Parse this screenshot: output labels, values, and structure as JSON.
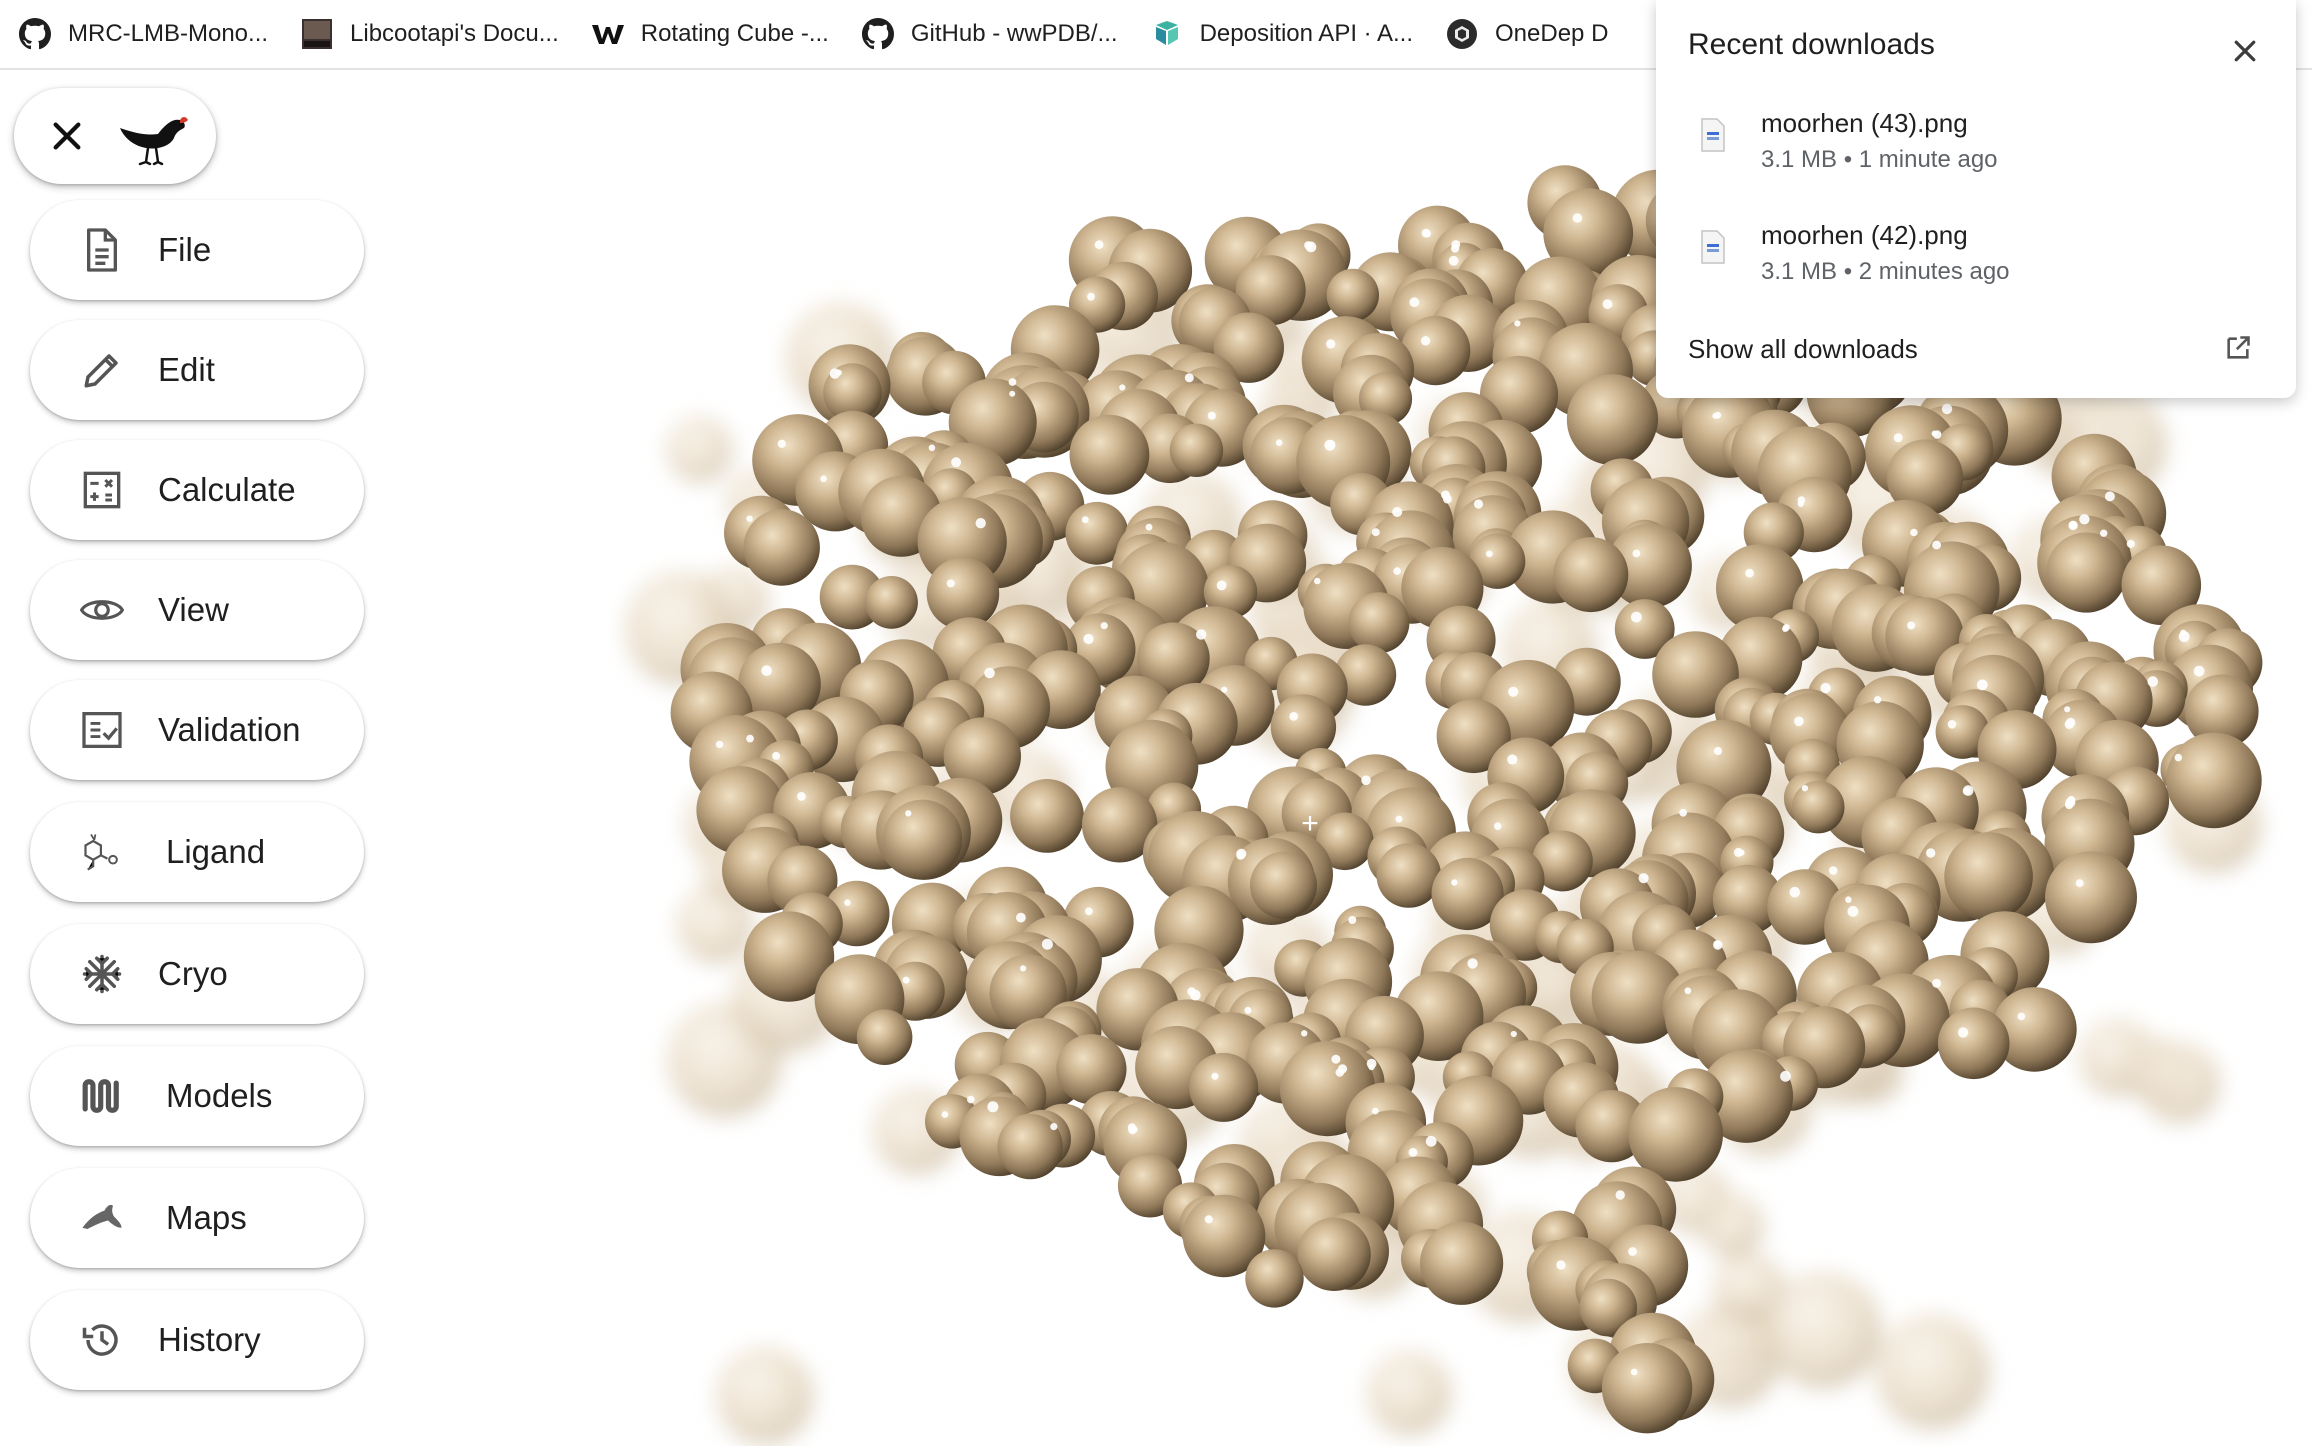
{
  "bookmarks": [
    {
      "label": "MRC-LMB-Mono...",
      "icon": "github-icon"
    },
    {
      "label": "Libcootapi's Docu...",
      "icon": "mrc-lmb-icon"
    },
    {
      "label": "Rotating Cube -...",
      "icon": "webflow-icon"
    },
    {
      "label": "GitHub - wwPDB/...",
      "icon": "github-icon"
    },
    {
      "label": "Deposition API · A...",
      "icon": "deposition-icon"
    },
    {
      "label": "OneDep D",
      "icon": "onedep-icon"
    }
  ],
  "app": {
    "logo": "moorhen-bird-icon",
    "close_icon": "close-icon"
  },
  "menu": [
    {
      "label": "File",
      "icon": "file-icon"
    },
    {
      "label": "Edit",
      "icon": "pencil-icon"
    },
    {
      "label": "Calculate",
      "icon": "calculator-icon"
    },
    {
      "label": "View",
      "icon": "eye-icon"
    },
    {
      "label": "Validation",
      "icon": "checklist-icon"
    },
    {
      "label": "Ligand",
      "icon": "ligand-icon"
    },
    {
      "label": "Cryo",
      "icon": "snowflake-icon"
    },
    {
      "label": "Models",
      "icon": "models-icon"
    },
    {
      "label": "Maps",
      "icon": "maps-icon"
    },
    {
      "label": "History",
      "icon": "history-icon"
    }
  ],
  "downloads": {
    "title": "Recent downloads",
    "items": [
      {
        "name": "moorhen (43).png",
        "meta": "3.1 MB • 1 minute ago"
      },
      {
        "name": "moorhen (42).png",
        "meta": "3.1 MB • 2 minutes ago"
      }
    ],
    "show_all": "Show all downloads"
  },
  "colors": {
    "surface": "#c9b08c",
    "surface_shadow": "#4e3f2b",
    "surface_light": "#efe0c4"
  }
}
